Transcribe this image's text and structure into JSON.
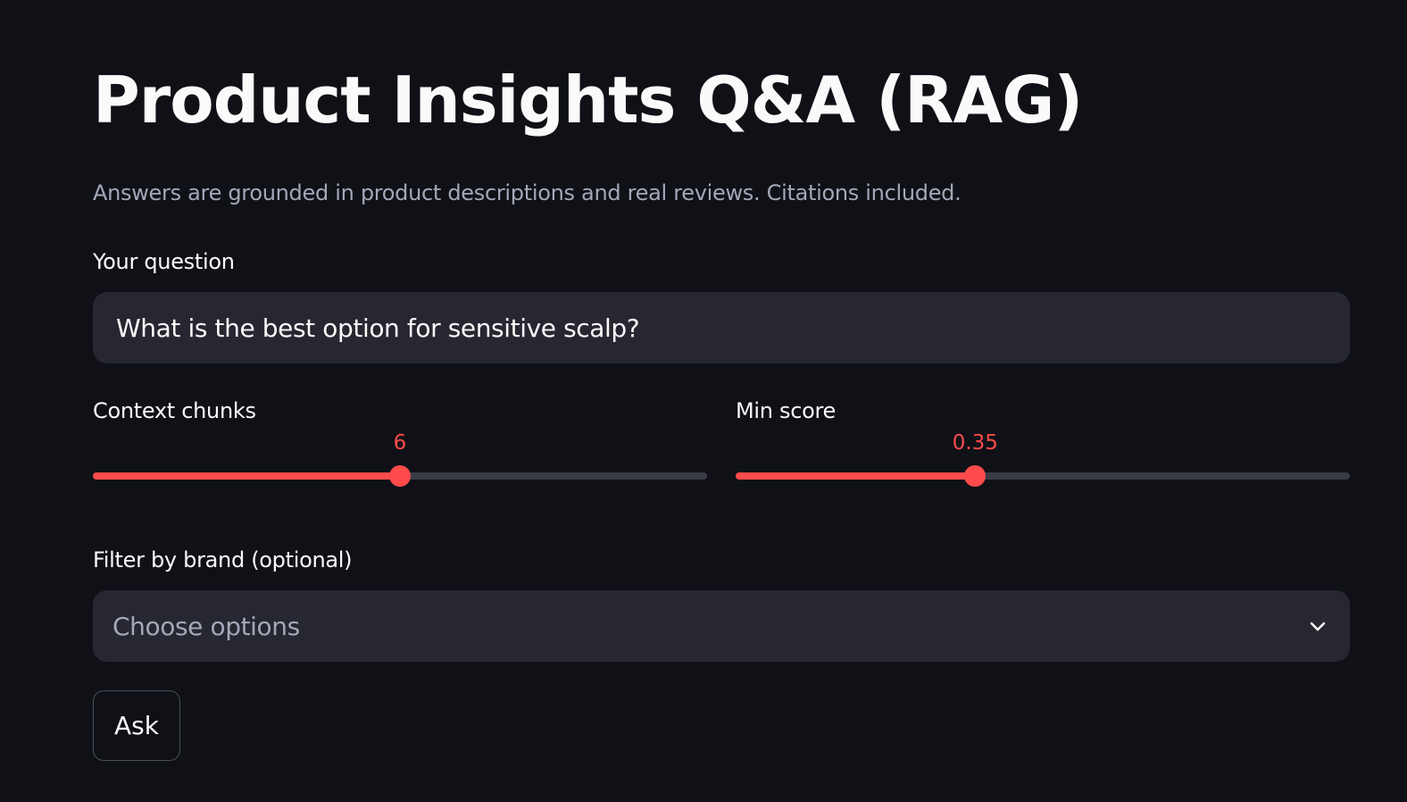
{
  "page": {
    "title": "Product Insights Q&A (RAG)",
    "caption": "Answers are grounded in product descriptions and real reviews. Citations included."
  },
  "question": {
    "label": "Your question",
    "value": "What is the best option for sensitive scalp?"
  },
  "context_chunks": {
    "label": "Context chunks",
    "value": "6",
    "fill_fraction": 0.5
  },
  "min_score": {
    "label": "Min score",
    "value": "0.35",
    "fill_fraction": 0.39
  },
  "brand_filter": {
    "label": "Filter by brand (optional)",
    "placeholder": "Choose options",
    "icon": "chevron-down-icon"
  },
  "actions": {
    "ask_label": "Ask"
  },
  "colors": {
    "background": "#0f1117",
    "accent": "#ff4b4b",
    "input_background": "#262730",
    "muted_text": "#a3a8b8"
  }
}
